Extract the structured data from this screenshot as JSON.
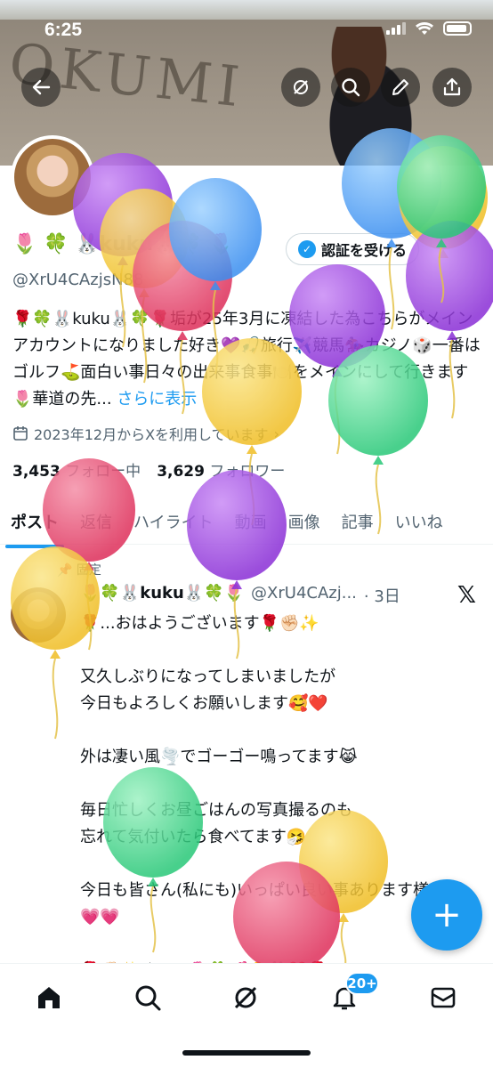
{
  "status_bar": {
    "time": "6:25"
  },
  "banner": {
    "sand_text": "OKUMI"
  },
  "header_buttons": [
    "back-arrow-icon",
    "grok-icon",
    "search-icon",
    "edit-icon",
    "share-icon"
  ],
  "profile": {
    "display_name": "🌷 🍀 🐰kuku🐰🍀 🌷",
    "handle": "@XrU4CAzjsN88",
    "verify_label": "認証を受ける",
    "bio_text": "🌹🍀🐰kuku🐰🍀🌹垢が25年3月に凍結した為こちらがメインアカウントになりました好き💜🎣旅行✈️競馬🏇カジノ🎲一番はゴルフ⛳面白い事日々の出来事食事🍽️をメインにして行きます🌷華道の先...",
    "bio_more": "さらに表示",
    "joined": "2023年12月からXを利用しています",
    "following_count": "3,453",
    "following_label": "フォロー中",
    "followers_count": "3,629",
    "followers_label": "フォロワー"
  },
  "tabs": [
    "ポスト",
    "返信",
    "ハイライト",
    "動画",
    "画像",
    "記事",
    "いいね"
  ],
  "tweet": {
    "pinned_label": "固定",
    "author": "🌷🍀🐰kuku🐰🍀🌷",
    "handle": "@XrU4CAzj...",
    "time": "· 3日",
    "x_logo": "𝕏",
    "body": "🌹...おはようございます🌹✊🏻✨\n\n又久しぶりになってしまいましたが\n今日もよろしくお願いします🥰❤️\n\n外は凄い風🌪️でゴーゴー鳴ってます😹\n\n毎日忙しくお昼ごはんの写真撮るのも\n忘れて気付いたら食べてます🤧\n\n今日も皆さん(私にも)いっぱい良い事あります様に💗💗💗\n\n🌹✊🏻✨ぐぅっ🌷🍀💕🐥🐰❤️🌹"
  },
  "fab_label": "+",
  "bottom_nav": {
    "notification_badge": "20+"
  },
  "balloon_colors": {
    "purple": "#9b3fe0",
    "blue": "#4aa3f5",
    "green": "#3ed98a",
    "yellow": "#f4cc3a",
    "red": "#e8416a"
  }
}
